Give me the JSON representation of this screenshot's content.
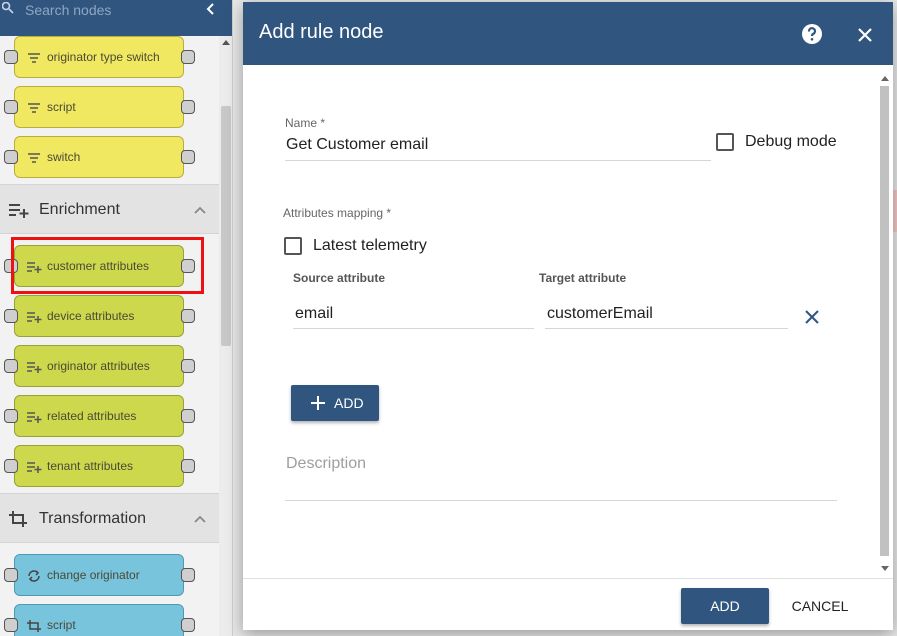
{
  "library": {
    "search_placeholder": "Search nodes",
    "filter_nodes": [
      {
        "label": "originator type switch"
      },
      {
        "label": "script"
      },
      {
        "label": "switch"
      }
    ],
    "enrichment": {
      "title": "Enrichment",
      "nodes": [
        {
          "label": "customer attributes"
        },
        {
          "label": "device attributes"
        },
        {
          "label": "originator attributes"
        },
        {
          "label": "related attributes"
        },
        {
          "label": "tenant attributes"
        }
      ]
    },
    "transformation": {
      "title": "Transformation",
      "nodes": [
        {
          "label": "change originator"
        },
        {
          "label": "script"
        }
      ]
    }
  },
  "dialog": {
    "title": "Add rule node",
    "name_label": "Name *",
    "name_value": "Get Customer email",
    "debug_label": "Debug mode",
    "attributes_mapping_label": "Attributes mapping *",
    "latest_telemetry_label": "Latest telemetry",
    "source_header": "Source attribute",
    "target_header": "Target attribute",
    "mapping": {
      "source": "email",
      "target": "customerEmail"
    },
    "add_mapping_label": "ADD",
    "description_placeholder": "Description",
    "add_button": "ADD",
    "cancel_button": "CANCEL"
  },
  "colors": {
    "header": "#305680",
    "filter_node": "#f1e861",
    "enrichment_node": "#cdd84d",
    "transformation_node": "#79c4dd",
    "highlight": "#ee1111"
  }
}
